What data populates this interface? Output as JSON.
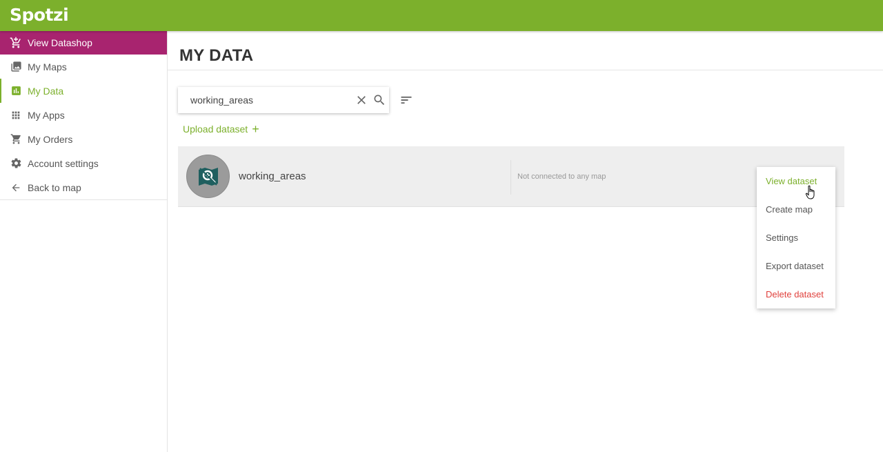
{
  "app": {
    "logo": "Spotzi",
    "brand_color": "#7cb02c",
    "accent_color": "#a8246f"
  },
  "sidebar": {
    "items": [
      {
        "label": "View Datashop",
        "icon": "cart-plus-icon"
      },
      {
        "label": "My Maps",
        "icon": "photo-library-icon"
      },
      {
        "label": "My Data",
        "icon": "bar-chart-icon"
      },
      {
        "label": "My Apps",
        "icon": "grid-icon"
      },
      {
        "label": "My Orders",
        "icon": "cart-icon"
      },
      {
        "label": "Account settings",
        "icon": "gear-icon"
      },
      {
        "label": "Back to map",
        "icon": "arrow-left-icon"
      }
    ]
  },
  "main": {
    "title": "MY DATA",
    "search": {
      "value": "working_areas"
    },
    "upload_label": "Upload dataset",
    "dataset": {
      "name": "working_areas",
      "status": "Not connected to any map"
    },
    "menu": {
      "items": [
        {
          "label": "View dataset"
        },
        {
          "label": "Create map"
        },
        {
          "label": "Settings"
        },
        {
          "label": "Export dataset"
        },
        {
          "label": "Delete dataset"
        }
      ]
    }
  }
}
